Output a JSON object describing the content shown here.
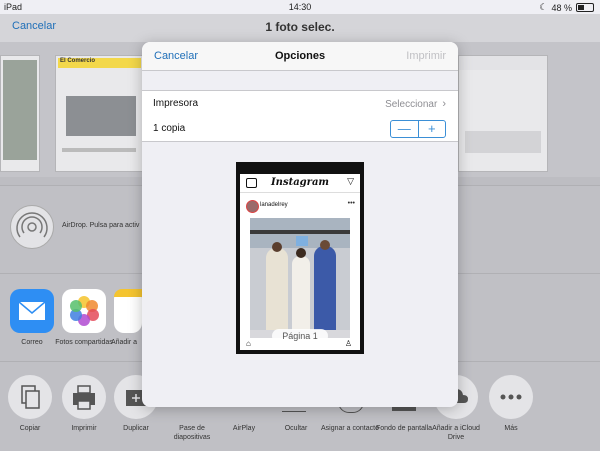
{
  "status_bar": {
    "device": "iPad",
    "time": "14:30",
    "battery": "48 %"
  },
  "background": {
    "cancel": "Cancelar",
    "title": "1 foto selec.",
    "thumbnail_site_name": "El Comercio",
    "airdrop_text": "AirDrop. Pulsa para activ",
    "share_apps": [
      {
        "label": "Correo",
        "icon": "mail-icon"
      },
      {
        "label": "Fotos compartidas",
        "icon": "photos-icon"
      },
      {
        "label": "Añadir a",
        "icon": "notes-icon"
      }
    ],
    "actions": [
      {
        "label": "Copiar",
        "icon": "copy-icon"
      },
      {
        "label": "Imprimir",
        "icon": "printer-icon"
      },
      {
        "label": "Duplicar",
        "icon": "duplicate-icon"
      },
      {
        "label": "Pase de diapositivas",
        "icon": "slideshow-icon"
      },
      {
        "label": "AirPlay",
        "icon": "airplay-icon"
      },
      {
        "label": "Ocultar",
        "icon": "hide-icon"
      },
      {
        "label": "Asignar a contacto",
        "icon": "contact-icon"
      },
      {
        "label": "Fondo de pantalla",
        "icon": "wallpaper-icon"
      },
      {
        "label": "Añadir a iCloud Drive",
        "icon": "cloud-icon"
      },
      {
        "label": "Más",
        "icon": "more-icon"
      }
    ]
  },
  "dialog": {
    "cancel": "Cancelar",
    "title": "Opciones",
    "print": "Imprimir",
    "printer_label": "Impresora",
    "printer_value": "Seleccionar",
    "copies_label": "1 copia",
    "stepper_minus": "—",
    "stepper_plus": "+",
    "preview": {
      "app_name": "Instagram",
      "username": "lanadelrey",
      "page_label": "Página 1"
    }
  },
  "colors": {
    "accent": "#1f6fb8",
    "stepper": "#3b8fd6",
    "disabled": "#c0c0c4"
  }
}
